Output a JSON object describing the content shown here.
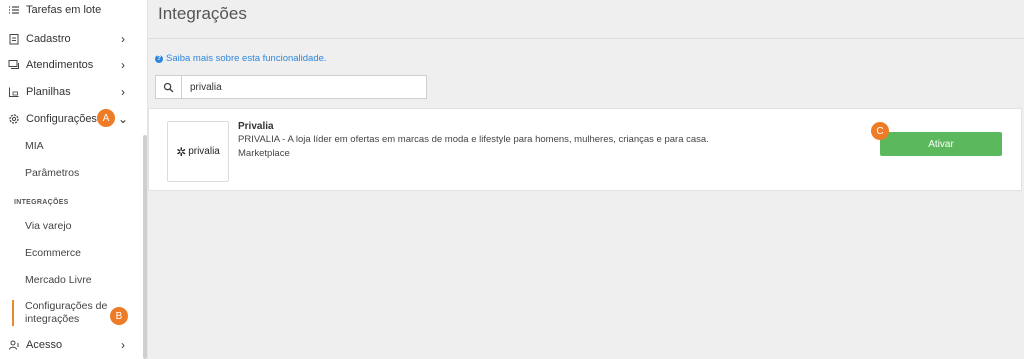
{
  "sidebar": {
    "items": [
      {
        "label": "Tarefas em lote",
        "icon": "list-icon"
      },
      {
        "label": "Cadastro",
        "icon": "clipboard-icon"
      },
      {
        "label": "Atendimentos",
        "icon": "chat-icon"
      },
      {
        "label": "Planilhas",
        "icon": "spreadsheet-icon"
      },
      {
        "label": "Configurações",
        "icon": "gear-icon"
      },
      {
        "label": "Acesso",
        "icon": "users-icon"
      }
    ],
    "config_subitems": [
      "MIA",
      "Parâmetros"
    ],
    "section_label": "INTEGRAÇÕES",
    "integration_subitems": [
      "Via varejo",
      "Ecommerce",
      "Mercado Livre"
    ],
    "active_item_line1": "Configurações de",
    "active_item_line2": "integrações"
  },
  "callouts": {
    "a": "A",
    "b": "B",
    "c": "C"
  },
  "main": {
    "title": "Integrações",
    "info_link": "Saiba mais sobre esta funcionalidade.",
    "search_value": "privalia"
  },
  "card": {
    "logo_text": "privalia",
    "name": "Privalia",
    "description": "PRIVALIA - A loja líder em ofertas em marcas de moda e lifestyle para homens, mulheres, crianças e para casa.",
    "category": "Marketplace",
    "button_label": "Ativar"
  },
  "colors": {
    "accent": "#ee7b25",
    "link": "#2e86de",
    "button": "#5cb85c"
  }
}
